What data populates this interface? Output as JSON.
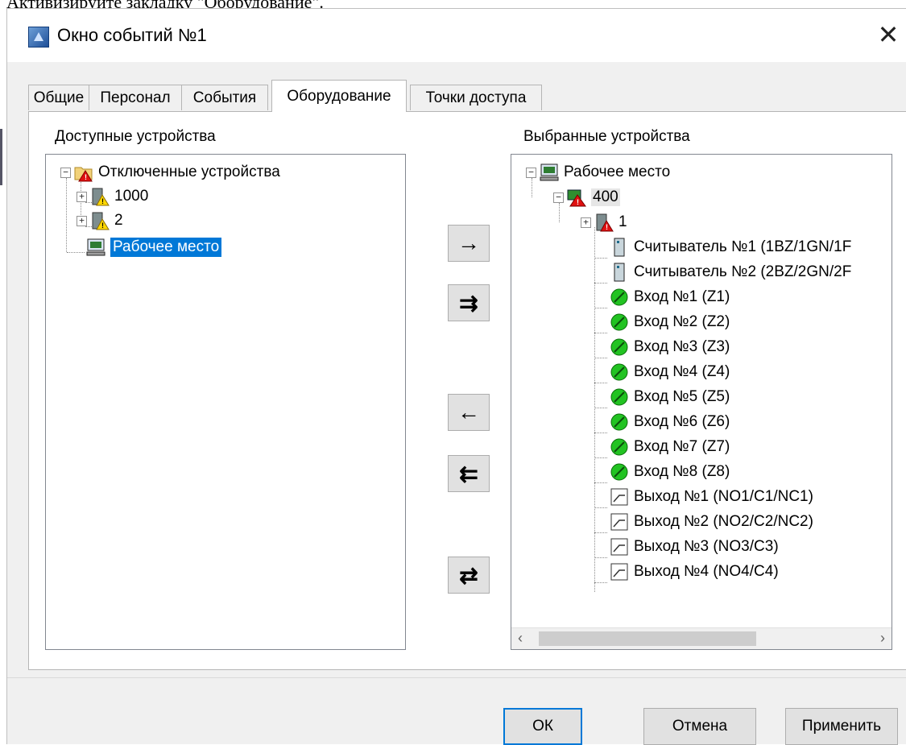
{
  "top_text": "Активизируйте закладку \"Оборудование\".",
  "window": {
    "title": "Окно событий №1",
    "close_label": "✕"
  },
  "tabs": [
    {
      "label": "Общие"
    },
    {
      "label": "Персонал"
    },
    {
      "label": "События"
    },
    {
      "label": "Оборудование",
      "active": true
    },
    {
      "label": "Точки доступа"
    }
  ],
  "available": {
    "label": "Доступные устройства",
    "items": [
      {
        "label": "Отключенные устройства",
        "icon": "folder-warning-icon",
        "expander": "−"
      },
      {
        "label": "1000",
        "icon": "door-warning-icon",
        "expander": "+"
      },
      {
        "label": "2",
        "icon": "door-warning-icon",
        "expander": "+"
      },
      {
        "label": "Рабочее место",
        "icon": "workstation-icon",
        "selected": true
      }
    ]
  },
  "selected": {
    "label": "Выбранные устройства",
    "items": [
      {
        "label": "Рабочее место",
        "icon": "workstation-icon",
        "expander": "−"
      },
      {
        "label": "400",
        "icon": "controller-alarm-icon",
        "expander": "−"
      },
      {
        "label": "1",
        "icon": "door-alarm-icon",
        "expander": "+"
      },
      {
        "label": "Считыватель №1 (1BZ/1GN/1F",
        "icon": "reader-icon"
      },
      {
        "label": "Считыватель №2 (2BZ/2GN/2F",
        "icon": "reader-icon"
      },
      {
        "label": "Вход №1 (Z1)",
        "icon": "input-ok-icon"
      },
      {
        "label": "Вход №2 (Z2)",
        "icon": "input-ok-icon"
      },
      {
        "label": "Вход №3 (Z3)",
        "icon": "input-ok-icon"
      },
      {
        "label": "Вход №4 (Z4)",
        "icon": "input-ok-icon"
      },
      {
        "label": "Вход №5 (Z5)",
        "icon": "input-ok-icon"
      },
      {
        "label": "Вход №6 (Z6)",
        "icon": "input-ok-icon"
      },
      {
        "label": "Вход №7 (Z7)",
        "icon": "input-ok-icon"
      },
      {
        "label": "Вход №8 (Z8)",
        "icon": "input-ok-icon"
      },
      {
        "label": "Выход №1 (NO1/C1/NC1)",
        "icon": "output-relay-icon"
      },
      {
        "label": "Выход №2 (NO2/C2/NC2)",
        "icon": "output-relay-icon"
      },
      {
        "label": "Выход №3 (NO3/C3)",
        "icon": "output-relay-icon"
      },
      {
        "label": "Выход №4 (NO4/C4)",
        "icon": "output-relay-icon"
      }
    ]
  },
  "transfer_buttons": {
    "add": "→",
    "add_all": "⇉",
    "remove": "←",
    "remove_all": "⇇",
    "swap": "⇄"
  },
  "scrollbar": {
    "left": "‹",
    "right": "›"
  },
  "buttons": {
    "ok": "ОК",
    "cancel": "Отмена",
    "apply": "Применить"
  },
  "colors": {
    "selection": "#0078d7",
    "warning": "#ffd800",
    "alarm": "#e01010",
    "ok_green": "#22c322"
  }
}
